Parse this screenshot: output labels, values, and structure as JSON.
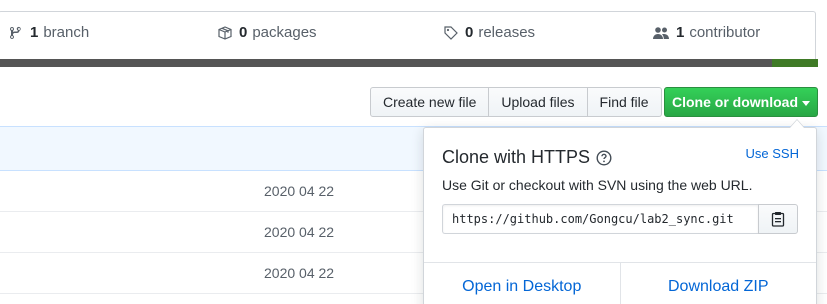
{
  "stats": {
    "branch": {
      "count": "1",
      "label": "branch",
      "icon": "git-branch-icon"
    },
    "packages": {
      "count": "0",
      "label": "packages",
      "icon": "package-icon"
    },
    "releases": {
      "count": "0",
      "label": "releases",
      "icon": "tag-icon"
    },
    "contributors": {
      "count": "1",
      "label": "contributor",
      "icon": "people-icon"
    }
  },
  "colors": {
    "accent_green": "#28a745",
    "link_blue": "#0366d6",
    "language_bar_primary": "#555555",
    "language_bar_secondary": "#3f7a26"
  },
  "toolbar": {
    "create_new_file": "Create new file",
    "upload_files": "Upload files",
    "find_file": "Find file",
    "clone_or_download": "Clone or download"
  },
  "file_rows": [
    {
      "date": "2020 04 22"
    },
    {
      "date": "2020 04 22"
    },
    {
      "date": "2020 04 22"
    }
  ],
  "clone_dropdown": {
    "title": "Clone with HTTPS",
    "use_ssh": "Use SSH",
    "description": "Use Git or checkout with SVN using the web URL.",
    "url": "https://github.com/Gongcu/lab2_sync.git",
    "open_in_desktop": "Open in Desktop",
    "download_zip": "Download ZIP"
  }
}
